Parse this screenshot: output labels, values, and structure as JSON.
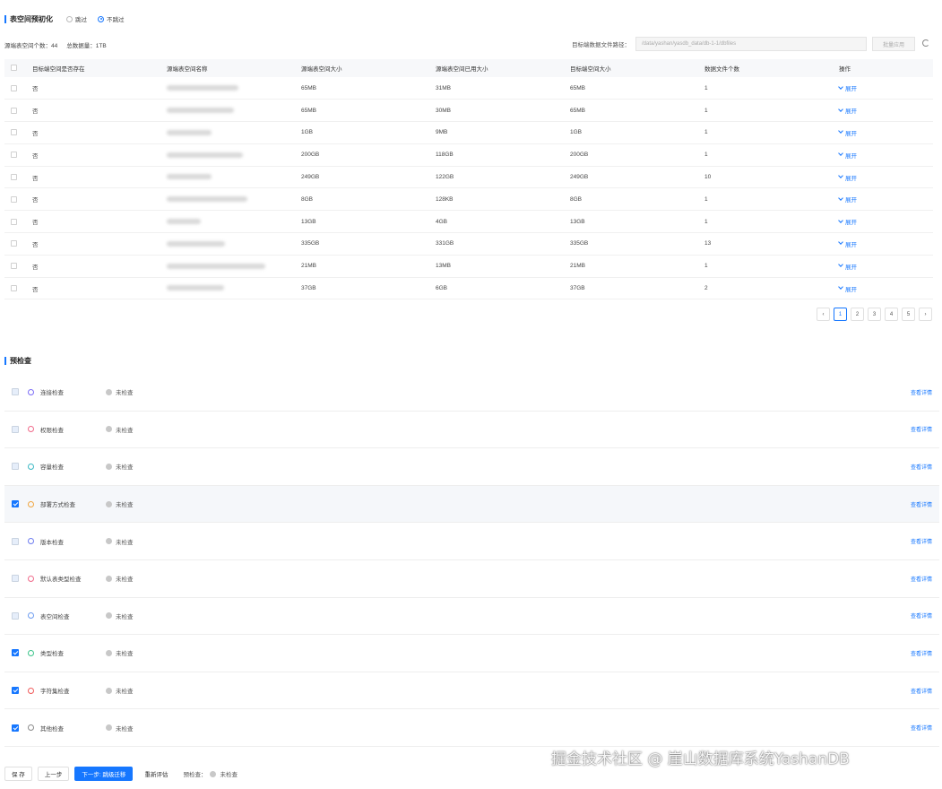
{
  "tablespace": {
    "title": "表空间预初化",
    "options": [
      "跳过",
      "不跳过"
    ],
    "selected": "不跳过",
    "stat_count": "源端表空间个数：44",
    "stat_total": "总数据量：1TB",
    "path_label": "目标端数据文件路径：",
    "path_placeholder": "/data/yashan/yasdb_data/db-1-1/dbfiles",
    "path_button": "批量应用",
    "columns": [
      "目标端空间是否存在",
      "源端表空间名称",
      "源端表空间大小",
      "源端表空间已用大小",
      "目标端空间大小",
      "数据文件个数",
      "操作"
    ],
    "rows": [
      {
        "exists": "否",
        "src_size": "65MB",
        "used": "31MB",
        "dst_size": "65MB",
        "files": "1",
        "op": "展开"
      },
      {
        "exists": "否",
        "src_size": "65MB",
        "used": "30MB",
        "dst_size": "65MB",
        "files": "1",
        "op": "展开"
      },
      {
        "exists": "否",
        "src_size": "1GB",
        "used": "9MB",
        "dst_size": "1GB",
        "files": "1",
        "op": "展开"
      },
      {
        "exists": "否",
        "src_size": "200GB",
        "used": "118GB",
        "dst_size": "200GB",
        "files": "1",
        "op": "展开"
      },
      {
        "exists": "否",
        "src_size": "249GB",
        "used": "122GB",
        "dst_size": "249GB",
        "files": "10",
        "op": "展开"
      },
      {
        "exists": "否",
        "src_size": "8GB",
        "used": "128KB",
        "dst_size": "8GB",
        "files": "1",
        "op": "展开"
      },
      {
        "exists": "否",
        "src_size": "13GB",
        "used": "4GB",
        "dst_size": "13GB",
        "files": "1",
        "op": "展开"
      },
      {
        "exists": "否",
        "src_size": "335GB",
        "used": "331GB",
        "dst_size": "335GB",
        "files": "13",
        "op": "展开"
      },
      {
        "exists": "否",
        "src_size": "21MB",
        "used": "13MB",
        "dst_size": "21MB",
        "files": "1",
        "op": "展开"
      },
      {
        "exists": "否",
        "src_size": "37GB",
        "used": "6GB",
        "dst_size": "37GB",
        "files": "2",
        "op": "展开"
      }
    ],
    "pages": [
      "1",
      "2",
      "3",
      "4",
      "5"
    ],
    "current_page": "1",
    "prev_glyph": "‹",
    "next_glyph": "›"
  },
  "precheck": {
    "title": "预检查",
    "items": [
      {
        "name": "连接检查",
        "status": "未检查",
        "detail": "查看详情",
        "checked": false,
        "icon": "link-icon",
        "icon_color": "#7b6cf6"
      },
      {
        "name": "权限检查",
        "status": "未检查",
        "detail": "查看详情",
        "checked": false,
        "icon": "shield-icon",
        "icon_color": "#f06a8a"
      },
      {
        "name": "容量检查",
        "status": "未检查",
        "detail": "查看详情",
        "checked": false,
        "icon": "capacity-icon",
        "icon_color": "#3bb8c4"
      },
      {
        "name": "部署方式检查",
        "status": "未检查",
        "detail": "查看详情",
        "checked": true,
        "icon": "deploy-icon",
        "icon_color": "#f0a640"
      },
      {
        "name": "版本检查",
        "status": "未检查",
        "detail": "查看详情",
        "checked": false,
        "icon": "version-icon",
        "icon_color": "#6d7cf0"
      },
      {
        "name": "默认表类型检查",
        "status": "未检查",
        "detail": "查看详情",
        "checked": false,
        "icon": "table-type-icon",
        "icon_color": "#f06a8a"
      },
      {
        "name": "表空间检查",
        "status": "未检查",
        "detail": "查看详情",
        "checked": false,
        "icon": "tablespace-icon",
        "icon_color": "#6d9cf0"
      },
      {
        "name": "类型检查",
        "status": "未检查",
        "detail": "查看详情",
        "checked": true,
        "icon": "type-icon",
        "icon_color": "#3bc48a"
      },
      {
        "name": "字符集检查",
        "status": "未检查",
        "detail": "查看详情",
        "checked": true,
        "icon": "charset-icon",
        "icon_color": "#f05a5a"
      },
      {
        "name": "其他检查",
        "status": "未检查",
        "detail": "查看详情",
        "checked": true,
        "icon": "other-icon",
        "icon_color": "#8a8a8a"
      }
    ]
  },
  "footer": {
    "save": "保 存",
    "prev": "上一步",
    "next": "下一步: 跳级迁移",
    "reeval": "重新评估",
    "precheck_label": "预检查：",
    "precheck_status": "未检查"
  },
  "watermark": "掘金技术社区 @ 崖山数据库系统YashanDB",
  "colors": {
    "primary": "#1677ff",
    "header_bg": "#f7f8fa"
  }
}
